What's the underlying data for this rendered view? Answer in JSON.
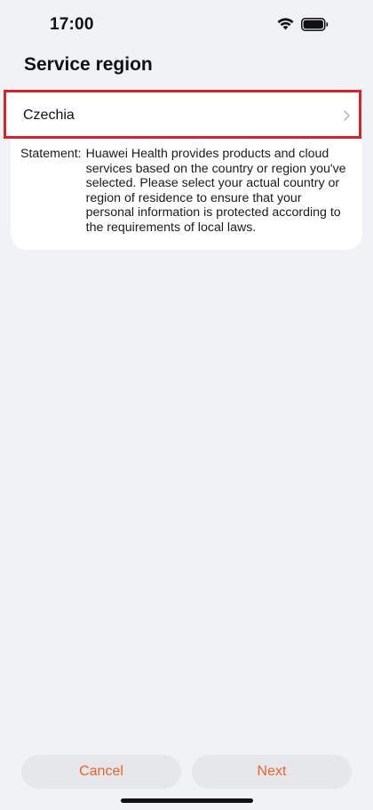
{
  "status_bar": {
    "time": "17:00",
    "wifi_icon": "wifi-icon",
    "battery_icon": "battery-icon"
  },
  "header": {
    "title": "Service region"
  },
  "region_selector": {
    "value": "Czechia",
    "chevron_icon": "chevron-right-icon",
    "highlight_color": "#d9222a"
  },
  "statement": {
    "label": "Statement:",
    "text": "Huawei Health provides products and cloud services based on the country or region you've selected. Please select your actual country or region of residence to ensure that your personal information is protected according to the requirements of local laws."
  },
  "footer": {
    "cancel_label": "Cancel",
    "next_label": "Next",
    "accent_color": "#e8642a"
  }
}
